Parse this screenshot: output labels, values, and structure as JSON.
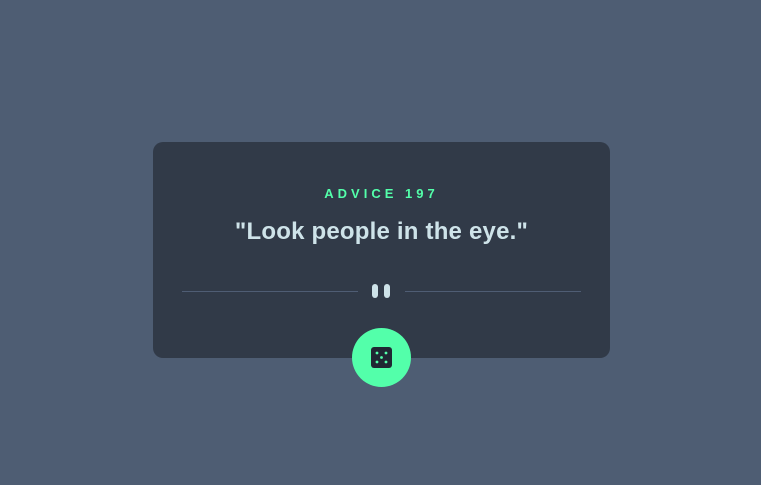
{
  "advice": {
    "id_label": "ADVICE 197",
    "text": "\"Look people in the eye.\""
  },
  "icons": {
    "divider": "pause-icon",
    "button": "dice-icon"
  },
  "colors": {
    "background": "#4e5d73",
    "card": "#313a48",
    "accent": "#53ffaa",
    "text": "#cee3e9"
  }
}
